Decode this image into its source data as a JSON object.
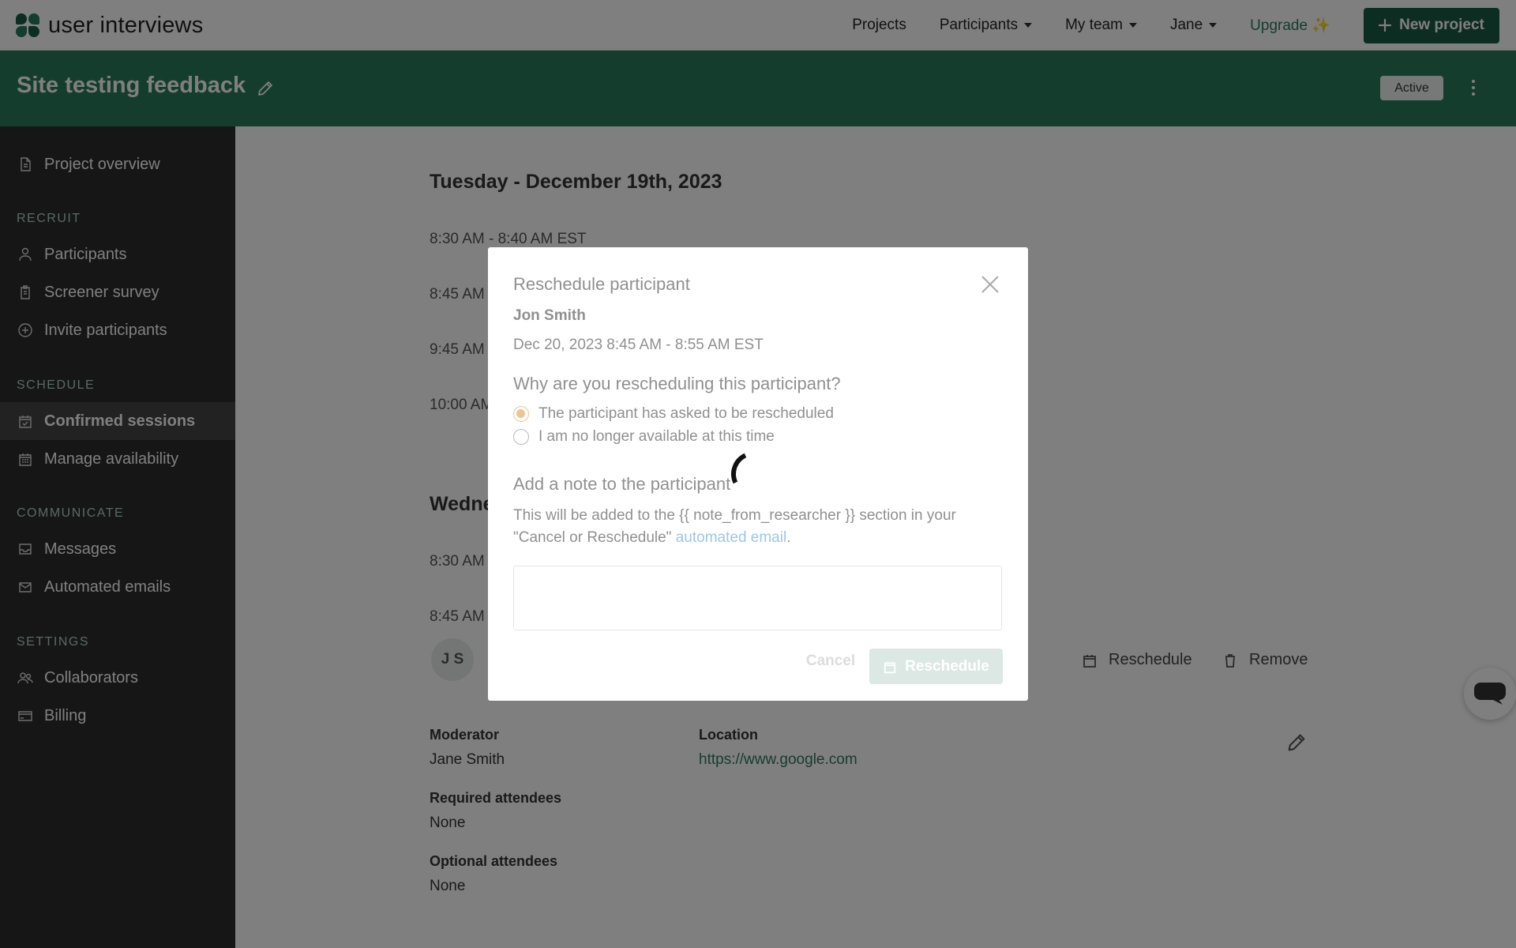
{
  "app": {
    "logo_text": "user interviews"
  },
  "topnav": {
    "projects": "Projects",
    "participants": "Participants",
    "my_team": "My team",
    "user": "Jane",
    "upgrade": "Upgrade ✨",
    "new_project": "New project"
  },
  "project": {
    "title": "Site testing feedback",
    "status": "Active"
  },
  "sidebar": {
    "overview": "Project overview",
    "sections": {
      "recruit": "RECRUIT",
      "schedule": "SCHEDULE",
      "communicate": "COMMUNICATE",
      "settings": "SETTINGS"
    },
    "items": {
      "participants": "Participants",
      "screener": "Screener survey",
      "invite": "Invite participants",
      "confirmed": "Confirmed sessions",
      "availability": "Manage availability",
      "messages": "Messages",
      "automated": "Automated emails",
      "collaborators": "Collaborators",
      "billing": "Billing"
    },
    "active_item": "confirmed"
  },
  "main": {
    "day1": {
      "heading": "Tuesday - December 19th, 2023",
      "slots": [
        "8:30 AM - 8:40 AM EST",
        "8:45 AM",
        "9:45 AM",
        "10:00 AM"
      ]
    },
    "day2": {
      "heading": "Wedne",
      "slots": [
        "8:30 AM",
        "8:45 AM"
      ]
    },
    "session": {
      "avatar_initials": "J S",
      "reschedule": "Reschedule",
      "remove": "Remove",
      "moderator_label": "Moderator",
      "moderator_value": "Jane Smith",
      "location_label": "Location",
      "location_value": "https://www.google.com",
      "required_label": "Required attendees",
      "required_value": "None",
      "optional_label": "Optional attendees",
      "optional_value": "None"
    }
  },
  "modal": {
    "title": "Reschedule participant",
    "participant_name": "Jon Smith",
    "session_time": "Dec 20, 2023 8:45 AM - 8:55 AM EST",
    "question": "Why are you rescheduling this participant?",
    "options": [
      {
        "label": "The participant has asked to be rescheduled",
        "checked": true
      },
      {
        "label": "I am no longer available at this time",
        "checked": false
      }
    ],
    "note_heading": "Add a note to the participant",
    "note_desc_before": "This will be added to the {{ note_from_researcher }} section in your \"Cancel or Reschedule\" ",
    "note_desc_link": "automated email",
    "note_desc_after": ".",
    "note_value": "",
    "cancel": "Cancel",
    "submit": "Reschedule",
    "loading": true
  },
  "colors": {
    "brand_dark": "#1c5a44",
    "brand": "#2a7a5b",
    "sidebar_bg": "#2d2d2d",
    "radio_accent": "#e08a2e",
    "link": "#3d8fd1"
  },
  "icons": {
    "close": "close-icon",
    "edit": "pencil-icon",
    "calendar": "calendar-icon",
    "trash": "trash-icon",
    "chat": "chat-icon"
  }
}
